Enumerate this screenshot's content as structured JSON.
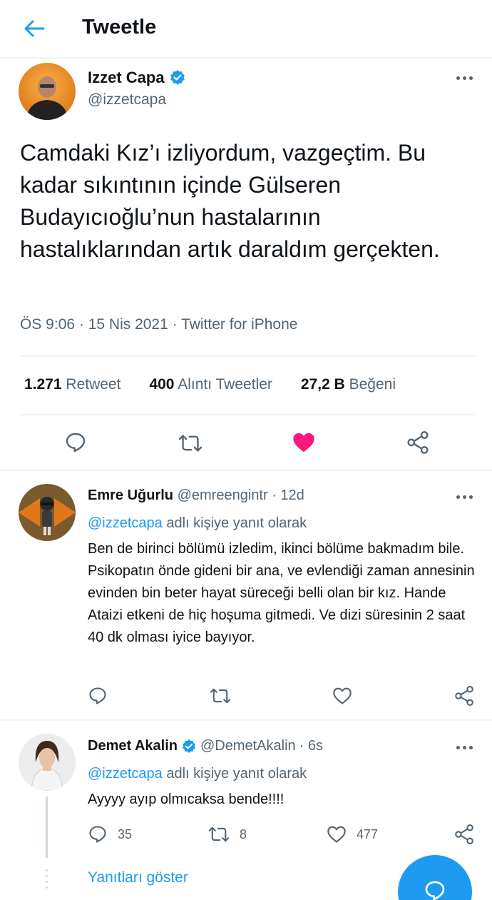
{
  "header": {
    "title": "Tweetle",
    "back_icon": "arrow-left-icon"
  },
  "main_tweet": {
    "name": "Izzet Capa",
    "handle": "@izzetcapa",
    "verified": true,
    "text": "Camdaki Kız’ı izliyordum, vazgeçtim. Bu kadar sıkıntının içinde Gülseren Budayıcıoğlu’nun hastalarının hastalıklarından artık daraldım gerçekten.",
    "meta": "ÖS 9:06 · 15 Nis 2021 · Twitter for iPhone",
    "stats": {
      "retweets_count": "1.271",
      "retweets_label": "Retweet",
      "quotes_count": "400",
      "quotes_label": "Alıntı Tweetler",
      "likes_count": "27,2 B",
      "likes_label": "Beğeni"
    },
    "liked": true
  },
  "replies": [
    {
      "name": "Emre Uğurlu",
      "handle": "@emreengintr",
      "time": "· 12d",
      "reply_to_mention": "@izzetcapa",
      "reply_to_suffix": " adlı kişiye yanıt olarak",
      "text": "Ben de birinci bölümü izledim, ikinci bölüme bakmadım bile. Psikopatın önde gideni bir ana, ve evlendiği zaman annesinin evinden bin beter hayat süreceği belli olan bir kız. Hande Ataizi etkeni de hiç hoşuma gitmedi. Ve dizi süresinin 2 saat 40 dk olması iyice bayıyor."
    },
    {
      "name": "Demet Akalin",
      "handle": "@DemetAkalin",
      "time": "· 6s",
      "verified": true,
      "reply_to_mention": "@izzetcapa",
      "reply_to_suffix": " adlı kişiye yanıt olarak",
      "text": "Ayyyy ayıp olmıcaksa bende!!!!",
      "reply_count": "35",
      "retweet_count": "8",
      "like_count": "477"
    }
  ],
  "show_replies_label": "Yanıtları göster",
  "colors": {
    "accent": "#1d9bf0",
    "like_red": "#f91880",
    "secondary_text": "#536471"
  }
}
